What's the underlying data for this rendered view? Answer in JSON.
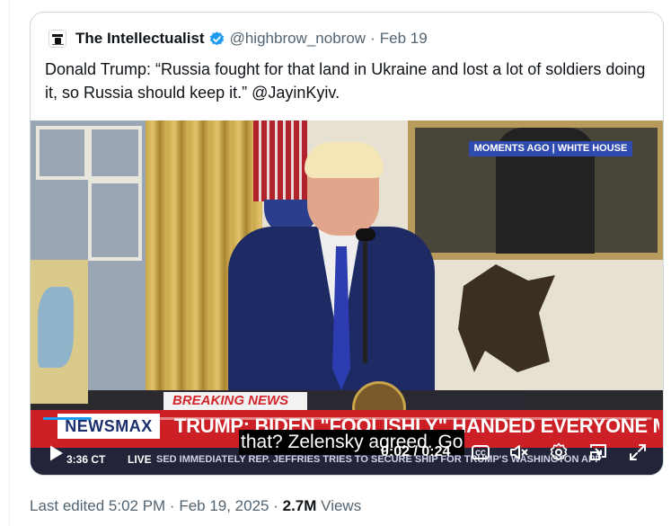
{
  "tweet": {
    "display_name": "The Intellectualist",
    "handle": "@highbrow_nobrow",
    "separator": "·",
    "date": "Feb 19",
    "text": "Donald Trump: “Russia fought for that land in Ukraine and lost a lot of soldiers doing it, so Russia should keep it.” @JayinKyiv."
  },
  "video": {
    "overlay_tag": "MOMENTS AGO | WHITE HOUSE",
    "breaking_label": "BREAKING NEWS",
    "network_logo": "NEWSMAX",
    "headline": "TRUMP: BIDEN \"FOOLISHLY\" HANDED EVERYONE MONEY",
    "clock": "3:36 CT",
    "live": "LIVE",
    "sub_ticker": "SED IMMEDIATELY      REP. JEFFRIES TRIES TO SECURE SHIP FOR TRUMP'S WASHINGTON APP",
    "caption": "that? Zelensky agreed. Go",
    "time_display": "0:02 / 0:24",
    "progress_fraction": 0.08
  },
  "meta": {
    "edited": "Last edited 5:02 PM · Feb 19, 2025 ·",
    "views_count": "2.7M",
    "views_label": "Views"
  },
  "colors": {
    "verified_blue": "#1d9bf0",
    "ticker_red": "#cc1f26",
    "muted_text": "#536471"
  },
  "icons": [
    "verified-badge-icon",
    "play-icon",
    "captions-icon",
    "mute-icon",
    "settings-icon",
    "picture-in-picture-icon",
    "fullscreen-icon"
  ]
}
